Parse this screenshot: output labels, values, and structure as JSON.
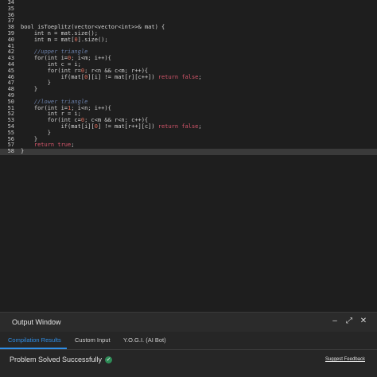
{
  "editor": {
    "lines": [
      {
        "n": "34",
        "segs": []
      },
      {
        "n": "35",
        "segs": []
      },
      {
        "n": "36",
        "segs": []
      },
      {
        "n": "37",
        "segs": []
      },
      {
        "n": "38",
        "segs": [
          [
            "ty",
            "bool isToeplitz(vector<vector<int>>& mat) {"
          ]
        ]
      },
      {
        "n": "39",
        "segs": [
          [
            "ty",
            "    int n = mat.size();"
          ]
        ]
      },
      {
        "n": "40",
        "segs": [
          [
            "ty",
            "    int m = mat["
          ],
          [
            "num",
            "0"
          ],
          [
            "ty",
            "].size();"
          ]
        ]
      },
      {
        "n": "41",
        "segs": []
      },
      {
        "n": "42",
        "segs": [
          [
            "cm",
            "    //upper triangle"
          ]
        ]
      },
      {
        "n": "43",
        "segs": [
          [
            "ty",
            "    for(int i="
          ],
          [
            "num",
            "0"
          ],
          [
            "ty",
            "; i<m; i++){"
          ]
        ]
      },
      {
        "n": "44",
        "segs": [
          [
            "ty",
            "        int c = i;"
          ]
        ]
      },
      {
        "n": "45",
        "segs": [
          [
            "ty",
            "        for(int r="
          ],
          [
            "num",
            "0"
          ],
          [
            "ty",
            "; r<n && c<m; r++){"
          ]
        ]
      },
      {
        "n": "46",
        "segs": [
          [
            "ty",
            "            if(mat["
          ],
          [
            "num",
            "0"
          ],
          [
            "ty",
            "][i] != mat[r][c++]) "
          ],
          [
            "rkw",
            "return false"
          ],
          [
            "ty",
            ";"
          ]
        ]
      },
      {
        "n": "47",
        "segs": [
          [
            "ty",
            "        }"
          ]
        ]
      },
      {
        "n": "48",
        "segs": [
          [
            "ty",
            "    }"
          ]
        ]
      },
      {
        "n": "49",
        "segs": []
      },
      {
        "n": "50",
        "segs": [
          [
            "cm",
            "    //lower triangle"
          ]
        ]
      },
      {
        "n": "51",
        "segs": [
          [
            "ty",
            "    for(int i="
          ],
          [
            "num",
            "1"
          ],
          [
            "ty",
            "; i<n; i++){"
          ]
        ]
      },
      {
        "n": "52",
        "segs": [
          [
            "ty",
            "        int r = i;"
          ]
        ]
      },
      {
        "n": "53",
        "segs": [
          [
            "ty",
            "        for(int c="
          ],
          [
            "num",
            "0"
          ],
          [
            "ty",
            "; c<m && r<n; c++){"
          ]
        ]
      },
      {
        "n": "54",
        "segs": [
          [
            "ty",
            "            if(mat[i]["
          ],
          [
            "num",
            "0"
          ],
          [
            "ty",
            "] != mat[r++][c]) "
          ],
          [
            "rkw",
            "return false"
          ],
          [
            "ty",
            ";"
          ]
        ]
      },
      {
        "n": "55",
        "segs": [
          [
            "ty",
            "        }"
          ]
        ]
      },
      {
        "n": "56",
        "segs": [
          [
            "ty",
            "    }"
          ]
        ]
      },
      {
        "n": "57",
        "segs": [
          [
            "rkw",
            "    return true"
          ],
          [
            "ty",
            ";"
          ]
        ]
      },
      {
        "n": "58",
        "segs": [
          [
            "ty",
            "}"
          ]
        ],
        "active": true
      }
    ]
  },
  "output": {
    "title": "Output Window",
    "tabs": [
      "Compilation Results",
      "Custom Input",
      "Y.O.G.I. (AI Bot)"
    ],
    "status": "Problem Solved Successfully",
    "feedback": "Suggest Feedback",
    "icons": [
      "minimize-icon",
      "expand-icon",
      "close-icon"
    ]
  }
}
